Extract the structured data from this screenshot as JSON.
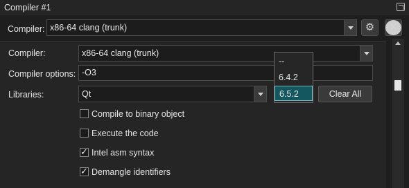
{
  "window": {
    "title": "Compiler #1"
  },
  "header": {
    "compiler_label": "Compiler:",
    "compiler_value": "x86-64 clang (trunk)",
    "settings_icon": "gear-icon",
    "close_icon": "close-icon"
  },
  "options": {
    "compiler_label": "Compiler:",
    "compiler_value": "x86-64 clang (trunk)",
    "compiler_options_label": "Compiler options:",
    "compiler_options_value": "-O3",
    "libraries_label": "Libraries:",
    "libraries_value": "Qt",
    "clear_all_label": "Clear All",
    "version_options": [
      "--",
      "6.4.2",
      "6.5.2"
    ],
    "selected_version": "6.5.2",
    "checkboxes": [
      {
        "label": "Compile to binary object",
        "checked": false
      },
      {
        "label": "Execute the code",
        "checked": false
      },
      {
        "label": "Intel asm syntax",
        "checked": true
      },
      {
        "label": "Demangle identifiers",
        "checked": true
      }
    ]
  },
  "colors": {
    "background": "#1e1e1e",
    "panel": "#252526",
    "selection": "#15575f"
  }
}
